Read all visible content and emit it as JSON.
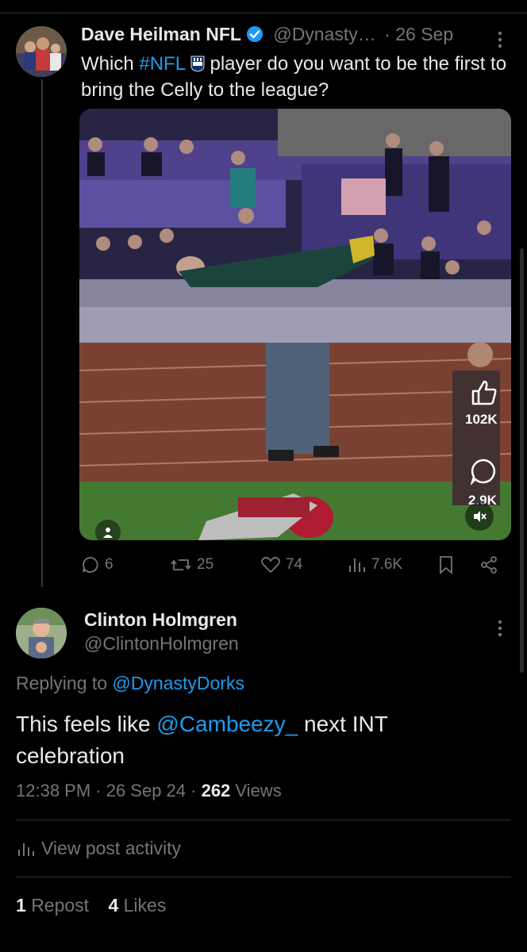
{
  "original_post": {
    "author_name": "Dave Heilman NFL",
    "handle": "@Dynasty…",
    "date": "· 26 Sep",
    "text_before_tag": "Which ",
    "hashtag": "#NFL",
    "text_after_tag": " player do you want to be the first to bring the Celly to the league?",
    "video_overlay": {
      "like_count": "102K",
      "comment_count": "2.9K"
    },
    "metrics": {
      "replies": "6",
      "reposts": "25",
      "likes": "74",
      "views": "7.6K"
    }
  },
  "reply": {
    "author_name": "Clinton Holmgren",
    "handle": "@ClintonHolmgren",
    "replying_prefix": "Replying to ",
    "replying_handle": "@DynastyDorks",
    "text_before_mention": "This feels like ",
    "mention": "@Cambeezy_",
    "text_after_mention": " next INT celebration",
    "time": "12:38 PM · 26 Sep 24 · ",
    "views_count": "262",
    "views_label": " Views",
    "activity_label": "View post activity",
    "reposts_count": "1",
    "reposts_label": "Repost",
    "likes_count": "4",
    "likes_label": "Likes"
  },
  "colors": {
    "background": "#000000",
    "text": "#e7e9ea",
    "muted": "#71767b",
    "link": "#1d9bf0",
    "verified": "#1d9bf0"
  }
}
